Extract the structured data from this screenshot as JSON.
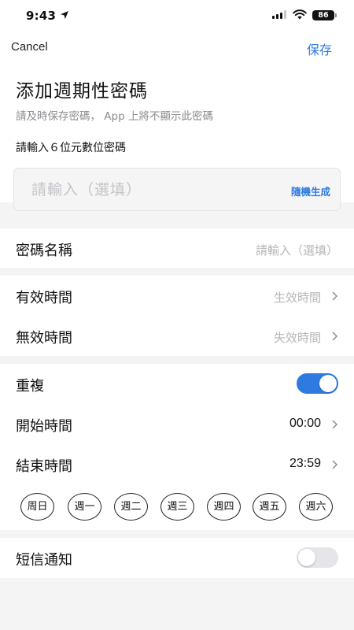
{
  "status_bar": {
    "time": "9:43",
    "battery": "86"
  },
  "nav": {
    "cancel": "Cancel",
    "save": "保存"
  },
  "header": {
    "title": "添加週期性密碼",
    "subtitle": "請及時保存密碼，  App 上將不顯示此密碼",
    "pin_label": "請輸入６位元數位密碼",
    "pin_placeholder": "請輸入（選填）",
    "random_button": "隨機生成"
  },
  "name_row": {
    "label": "密碼名稱",
    "placeholder": "請輸入（選填）"
  },
  "validity": {
    "effective": {
      "label": "有效時間",
      "value": "生效時間"
    },
    "expiry": {
      "label": "無效時間",
      "value": "失效時間"
    }
  },
  "repeat": {
    "label": "重複",
    "enabled": true,
    "start": {
      "label": "開始時間",
      "value": "00:00"
    },
    "end": {
      "label": "結束時間",
      "value": "23:59"
    },
    "days": [
      "周日",
      "週一",
      "週二",
      "週三",
      "週四",
      "週五",
      "週六"
    ]
  },
  "sms": {
    "label": "短信通知",
    "enabled": false
  },
  "colors": {
    "accent": "#2f7ae0",
    "background": "#f4f4f5",
    "placeholder": "#b6b6ba"
  }
}
